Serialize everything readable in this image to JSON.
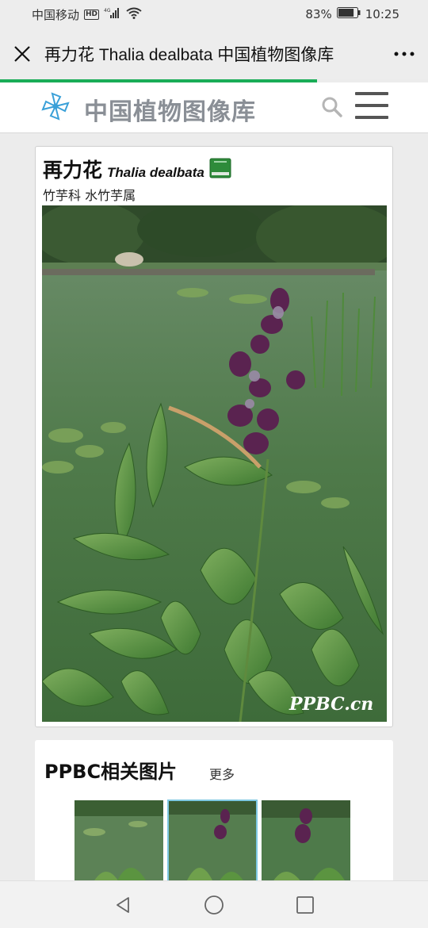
{
  "status_bar": {
    "carrier": "中国移动",
    "hd_label": "HD",
    "network": "4G",
    "battery": "83%",
    "time": "10:25"
  },
  "title_bar": {
    "title": "再力花 Thalia dealbata 中国植物图像库",
    "close_icon": "close-icon",
    "more_icon": "more-dots-icon",
    "load_progress": 0.74
  },
  "site_header": {
    "logo_text": "中国植物图像库",
    "search_icon": "search-icon",
    "menu_icon": "hamburger-menu-icon"
  },
  "species": {
    "chinese_name": "再力花",
    "latin_name": "Thalia dealbata",
    "family_genus": "竹芋科 水竹芋属",
    "watermark": "PPBC.cn"
  },
  "related": {
    "title": "PPBC相关图片",
    "more_label": "更多",
    "thumbnails": [
      "thumb-1",
      "thumb-2",
      "thumb-3"
    ],
    "selected_index": 1
  },
  "colors": {
    "progress": "#1aad57",
    "logo_gray": "#8a8f96",
    "logo_blue": "#3aa0d8",
    "book_green": "#2e8b3a"
  }
}
